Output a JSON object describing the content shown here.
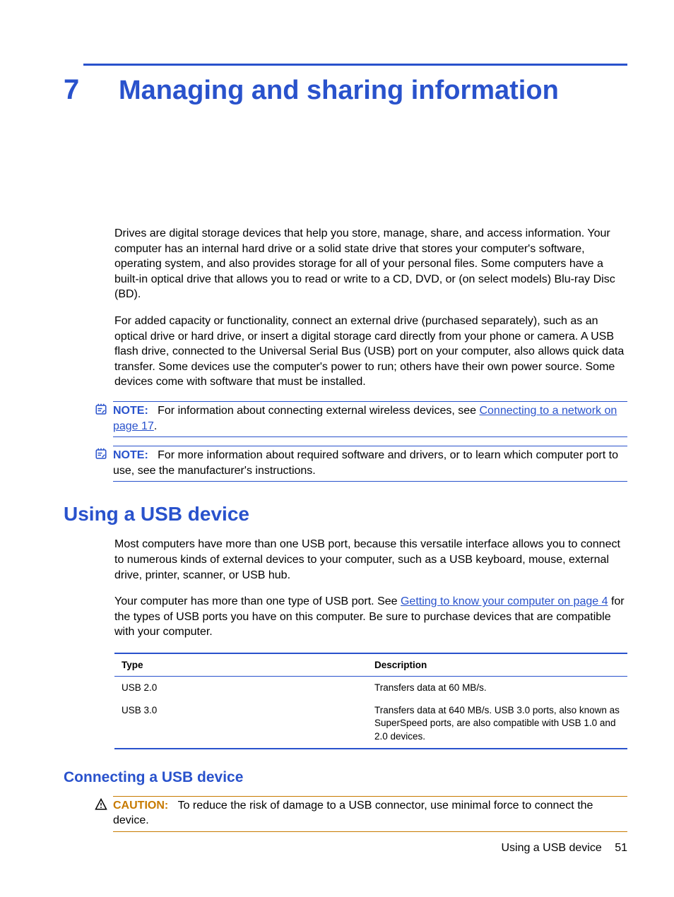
{
  "chapter": {
    "number": "7",
    "title": "Managing and sharing information"
  },
  "intro": {
    "p1": "Drives are digital storage devices that help you store, manage, share, and access information. Your computer has an internal hard drive or a solid state drive that stores your computer's software, operating system, and also provides storage for all of your personal files. Some computers have a built-in optical drive that allows you to read or write to a CD, DVD, or (on select models) Blu-ray Disc (BD).",
    "p2": "For added capacity or functionality, connect an external drive (purchased separately), such as an optical drive or hard drive, or insert a digital storage card directly from your phone or camera. A USB flash drive, connected to the Universal Serial Bus (USB) port on your computer, also allows quick data transfer. Some devices use the computer's power to run; others have their own power source. Some devices come with software that must be installed."
  },
  "note1": {
    "label": "NOTE:",
    "pre": "For information about connecting external wireless devices, see ",
    "link": "Connecting to a network on page 17",
    "post": "."
  },
  "note2": {
    "label": "NOTE:",
    "text": "For more information about required software and drivers, or to learn which computer port to use, see the manufacturer's instructions."
  },
  "section_usb": {
    "heading": "Using a USB device",
    "p1": "Most computers have more than one USB port, because this versatile interface allows you to connect to numerous kinds of external devices to your computer, such as a USB keyboard, mouse, external drive, printer, scanner, or USB hub.",
    "p2_pre": "Your computer has more than one type of USB port. See ",
    "p2_link": "Getting to know your computer on page 4",
    "p2_post": " for the types of USB ports you have on this computer. Be sure to purchase devices that are compatible with your computer."
  },
  "table": {
    "head_type": "Type",
    "head_desc": "Description",
    "rows": [
      {
        "type": "USB 2.0",
        "desc": "Transfers data at 60 MB/s."
      },
      {
        "type": "USB 3.0",
        "desc": "Transfers data at 640 MB/s. USB 3.0 ports, also known as SuperSpeed ports, are also compatible with USB 1.0 and 2.0 devices."
      }
    ]
  },
  "section_connect": {
    "heading": "Connecting a USB device"
  },
  "caution": {
    "label": "CAUTION:",
    "text": "To reduce the risk of damage to a USB connector, use minimal force to connect the device."
  },
  "footer": {
    "text": "Using a USB device",
    "page": "51"
  }
}
